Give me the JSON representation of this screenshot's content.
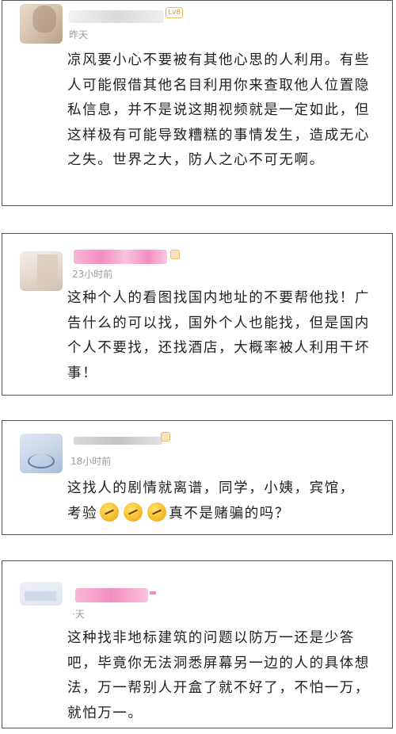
{
  "comments": [
    {
      "time": "昨天",
      "badge": "Lv8",
      "text": "凉风要小心不要被有其他心思的人利用。有些人可能假借其他名目利用你来查取他人位置隐私信息，并不是说这期视频就是一定如此，但这样极有可能导致糟糕的事情发生，造成无心之失。世界之大，防人之心不可无啊。"
    },
    {
      "time": "23小时前",
      "text": "这种个人的看图找国内地址的不要帮他找！广告什么的可以找，国外个人也能找，但是国内个人不要找，还找酒店，大概率被人利用干坏事！"
    },
    {
      "time": "18小时前",
      "text_line1": "这找人的剧情就离谱，同学，小姨，宾馆，",
      "text_line2_prefix": "考验",
      "text_line2_suffix": "真不是赌骗的吗？"
    },
    {
      "time": "·天",
      "text": "这种找非地标建筑的问题以防万一还是少答吧，毕竟你无法洞悉屏幕另一边的人的具体想法，万一帮别人开盒了就不好了，不怕一万，就怕万一。"
    }
  ],
  "colors": {
    "timestamp": "#9a9a9a",
    "card_border": "#555555",
    "badge": "#e9a33a"
  }
}
